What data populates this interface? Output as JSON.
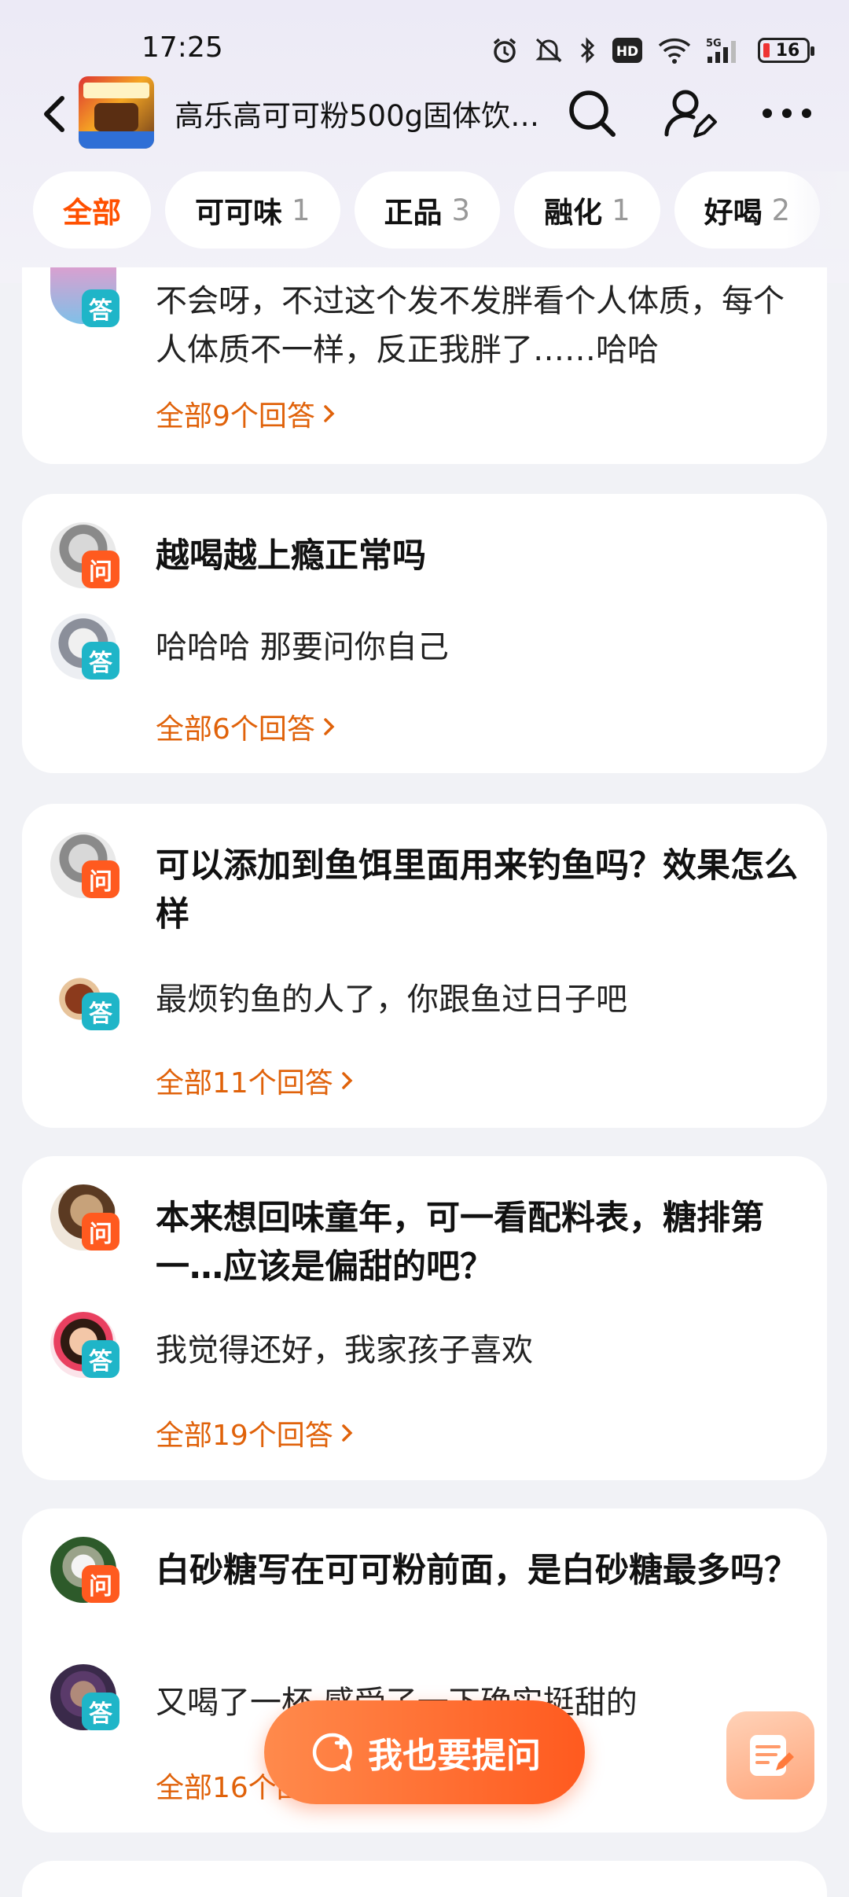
{
  "status_bar": {
    "time": "17:25",
    "battery": "16"
  },
  "header": {
    "title": "高乐高可可粉500g固体饮…"
  },
  "tabs": [
    {
      "label": "全部",
      "count": "",
      "active": true
    },
    {
      "label": "可可味",
      "count": "1"
    },
    {
      "label": "正品",
      "count": "3"
    },
    {
      "label": "融化",
      "count": "1"
    },
    {
      "label": "好喝",
      "count": "2"
    }
  ],
  "badges": {
    "question": "问",
    "answer": "答"
  },
  "cards": [
    {
      "answer": "不会呀，不过这个发不发胖看个人体质，每个人体质不一样，反正我胖了……哈哈",
      "more": "全部9个回答"
    },
    {
      "question": "越喝越上瘾正常吗",
      "answer": "哈哈哈  那要问你自己",
      "more": "全部6个回答"
    },
    {
      "question": "可以添加到鱼饵里面用来钓鱼吗？效果怎么样",
      "answer": "最烦钓鱼的人了，你跟鱼过日子吧",
      "more": "全部11个回答"
    },
    {
      "question": "本来想回味童年，可一看配料表，糖排第一…应该是偏甜的吧？",
      "answer": "我觉得还好，我家孩子喜欢",
      "more": "全部19个回答"
    },
    {
      "question": "白砂糖写在可可粉前面，是白砂糖最多吗？",
      "answer": "又喝了一杯 感受了一下确实挺甜的",
      "more": "全部16个回答"
    }
  ],
  "ask_button": "我也要提问",
  "colors": {
    "accent": "#ff5000",
    "more_link": "#e0620a",
    "question_badge": "#ff5a1f",
    "answer_badge": "#1fb5c8"
  }
}
